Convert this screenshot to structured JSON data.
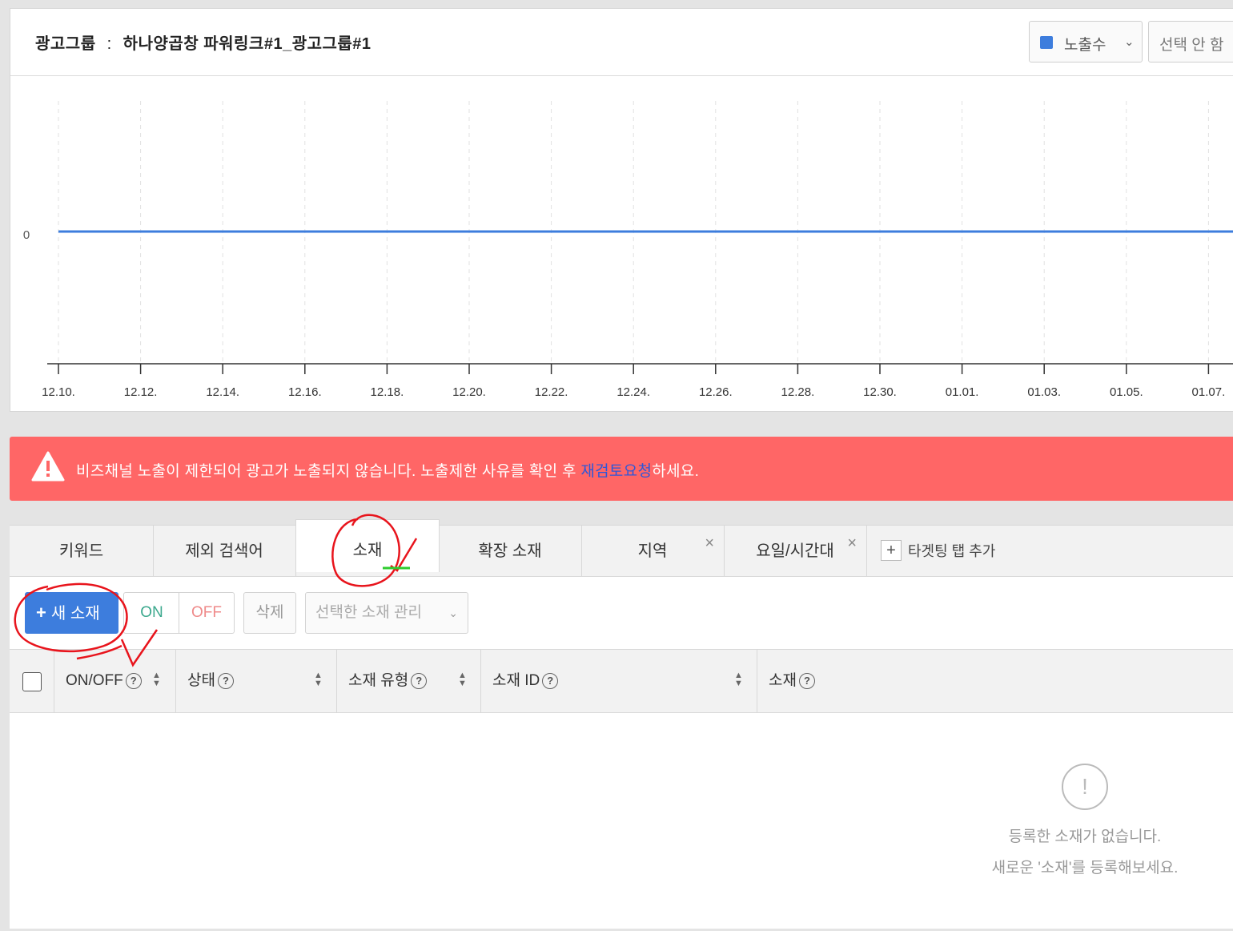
{
  "header": {
    "adgroup_label": "광고그룹",
    "separator": ":",
    "adgroup_name": "하나양곱창 파워링크#1_광고그룹#1",
    "metric_select": {
      "value": "노출수",
      "color": "#3d7ddd"
    },
    "compare_select": {
      "value": "선택 안 함"
    }
  },
  "chart_data": {
    "type": "line",
    "x": [
      "12.10.",
      "12.12.",
      "12.14.",
      "12.16.",
      "12.18.",
      "12.20.",
      "12.22.",
      "12.24.",
      "12.26.",
      "12.28.",
      "12.30.",
      "01.01.",
      "01.03.",
      "01.05.",
      "01.07."
    ],
    "series": [
      {
        "values": [
          0,
          0,
          0,
          0,
          0,
          0,
          0,
          0,
          0,
          0,
          0,
          0,
          0,
          0,
          0
        ],
        "color": "#3d7ddd"
      }
    ],
    "y_ticks": [
      "0"
    ],
    "grid": "vertical dashed"
  },
  "alert": {
    "text_before": "비즈채널 노출이 제한되어 광고가 노출되지 않습니다. 노출제한 사유를 확인 후 ",
    "link_text": "재검토요청",
    "text_after": "하세요.",
    "icon": "warning-triangle-icon",
    "color": "#ff6666"
  },
  "tabs": {
    "items": [
      {
        "label": "키워드"
      },
      {
        "label": "제외 검색어"
      },
      {
        "label": "소재",
        "active": true
      },
      {
        "label": "확장 소재"
      },
      {
        "label": "지역",
        "closable": true,
        "close": "×"
      },
      {
        "label": "요일/시간대",
        "closable": true,
        "close": "×"
      }
    ],
    "add_tab_label": "타겟팅 탭 추가",
    "add_tab_icon": "+"
  },
  "toolbar": {
    "new_button": "새 소재",
    "new_button_icon": "+",
    "on_button": "ON",
    "off_button": "OFF",
    "delete_button": "삭제",
    "manage_select": "선택한 소재 관리"
  },
  "table": {
    "columns": [
      {
        "label": "ON/OFF"
      },
      {
        "label": "상태"
      },
      {
        "label": "소재 유형"
      },
      {
        "label": "소재 ID"
      },
      {
        "label": "소재"
      }
    ],
    "help_glyph": "?",
    "empty_icon_glyph": "!",
    "empty_line1": "등록한 소재가 없습니다.",
    "empty_line2": "새로운 '소재'를 등록해보세요."
  }
}
